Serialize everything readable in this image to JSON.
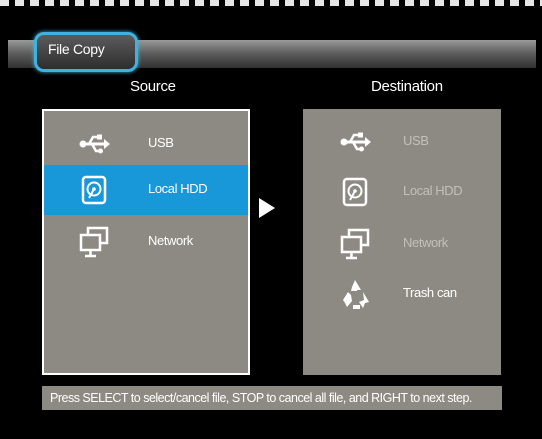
{
  "header": {
    "title": "File Copy"
  },
  "source": {
    "heading": "Source",
    "items": [
      {
        "label": "USB",
        "icon": "usb-icon"
      },
      {
        "label": "Local HDD",
        "icon": "hdd-icon",
        "selected": true
      },
      {
        "label": "Network",
        "icon": "network-icon"
      }
    ]
  },
  "destination": {
    "heading": "Destination",
    "items": [
      {
        "label": "USB",
        "icon": "usb-icon",
        "enabled": false
      },
      {
        "label": "Local HDD",
        "icon": "hdd-icon",
        "enabled": false
      },
      {
        "label": "Network",
        "icon": "network-icon",
        "enabled": false
      },
      {
        "label": "Trash can",
        "icon": "recycle-icon",
        "enabled": true
      }
    ]
  },
  "status_text": "Press SELECT to select/cancel file, STOP to cancel all file, and RIGHT to next step.",
  "colors": {
    "accent": "#1898d8",
    "panel": "#8c8a82",
    "tab_border": "#3fb3df"
  }
}
